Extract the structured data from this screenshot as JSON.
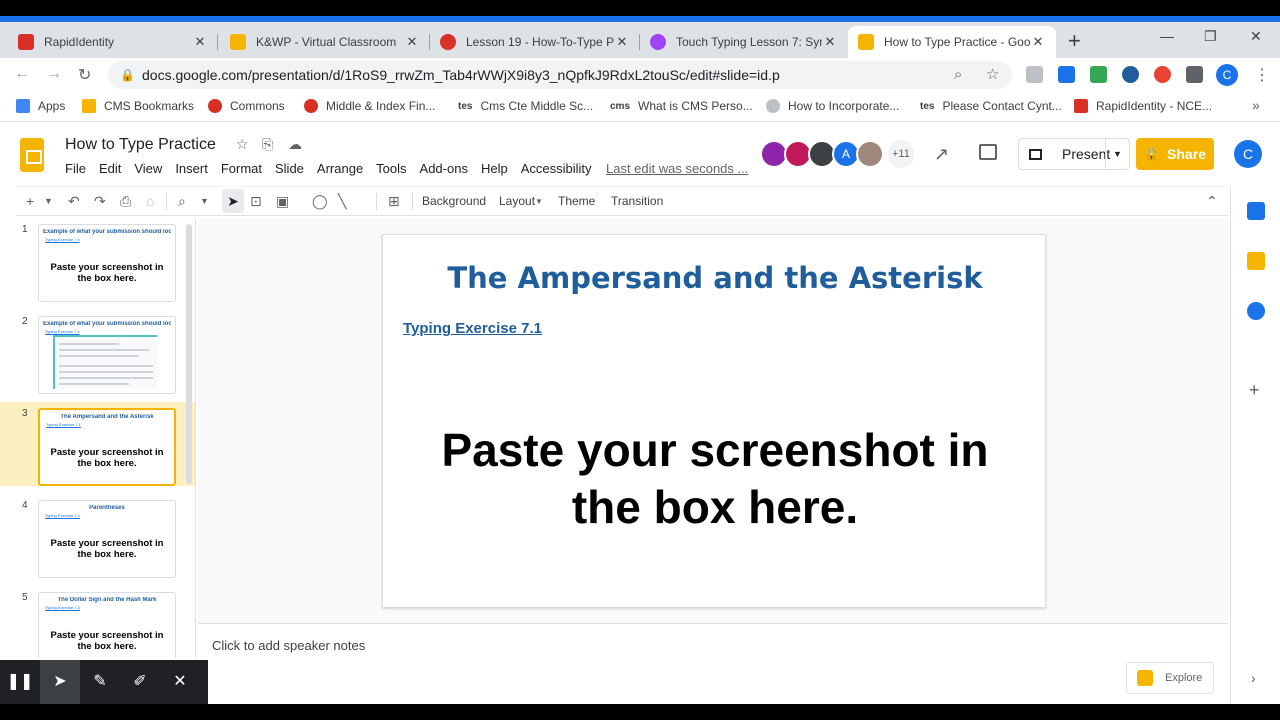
{
  "browser": {
    "tabs": [
      {
        "title": "RapidIdentity",
        "color": "#d93025"
      },
      {
        "title": "K&WP - Virtual Classroom",
        "color": "#f4b400"
      },
      {
        "title": "Lesson 19 - How-To-Type P",
        "color": "#d93025"
      },
      {
        "title": "Touch Typing Lesson 7: Sym",
        "color": "#a142f4"
      },
      {
        "title": "How to Type Practice - Goo",
        "color": "#f4b400",
        "active": true
      }
    ],
    "new_tab": "+",
    "url": "docs.google.com/presentation/d/1RoS9_rrwZm_Tab4rWWjX9i8y3_nQpfkJ9RdxL2touSc/edit#slide=id.p",
    "profile_letter": "C",
    "bookmarks": [
      {
        "label": "Apps",
        "color": "#4285f4"
      },
      {
        "label": "CMS Bookmarks",
        "color": "#f4b400"
      },
      {
        "label": "Commons",
        "color": "#d93025"
      },
      {
        "label": "Middle & Index Fin...",
        "color": "#d93025"
      },
      {
        "label": "Cms Cte Middle Sc...",
        "color": "#202124",
        "prefix": "tes"
      },
      {
        "label": "What is CMS Perso...",
        "color": "#202124",
        "prefix": "cms"
      },
      {
        "label": "How to Incorporate...",
        "color": "#9aa0a6"
      },
      {
        "label": "Please Contact Cynt...",
        "color": "#202124",
        "prefix": "tes"
      },
      {
        "label": "RapidIdentity - NCE...",
        "color": "#d93025"
      }
    ]
  },
  "docs": {
    "title": "How to Type Practice",
    "menu": [
      "File",
      "Edit",
      "View",
      "Insert",
      "Format",
      "Slide",
      "Arrange",
      "Tools",
      "Add-ons",
      "Help",
      "Accessibility"
    ],
    "last_edit": "Last edit was seconds ...",
    "collab_more": "+11",
    "collab_colors": [
      "#8e24aa",
      "#c2185b",
      "#3c4043",
      "#1a73e8",
      "#a1887f"
    ],
    "collab_a": "A",
    "present_label": "Present",
    "share_label": "Share",
    "account_letter": "C",
    "toolbar": {
      "background": "Background",
      "layout": "Layout",
      "theme": "Theme",
      "transition": "Transition"
    },
    "slides": [
      {
        "num": "1",
        "title": "Example of what your submission should look like:",
        "sub": "Typing Exercise 7.x",
        "body": "Paste your screenshot in the box here."
      },
      {
        "num": "2",
        "title": "Example of what your submission should look like:",
        "sub": "Typing Exercise 7.x",
        "body": ""
      },
      {
        "num": "3",
        "title": "The Ampersand and the Asterisk",
        "sub": "Typing Exercise 7.1",
        "body": "Paste your screenshot in the box here.",
        "selected": true
      },
      {
        "num": "4",
        "title": "Parentheses",
        "sub": "Typing Exercise 7.2",
        "body": "Paste your screenshot in the box here."
      },
      {
        "num": "5",
        "title": "The Dollar Sign and the Hash Mark",
        "sub": "Typing Exercise 7.3",
        "body": "Paste your screenshot in the box here."
      }
    ],
    "current_slide": {
      "title": "The Ampersand and the Asterisk",
      "link": "Typing Exercise 7.1",
      "body_line1": "Paste your screenshot in",
      "body_line2": "the box here."
    },
    "notes_placeholder": "Click to add speaker notes",
    "explore_label": "Explore"
  },
  "colors": {
    "accent": "#f4b400",
    "title_blue": "#1f5d9b",
    "chrome_blue": "#1a73e8"
  }
}
